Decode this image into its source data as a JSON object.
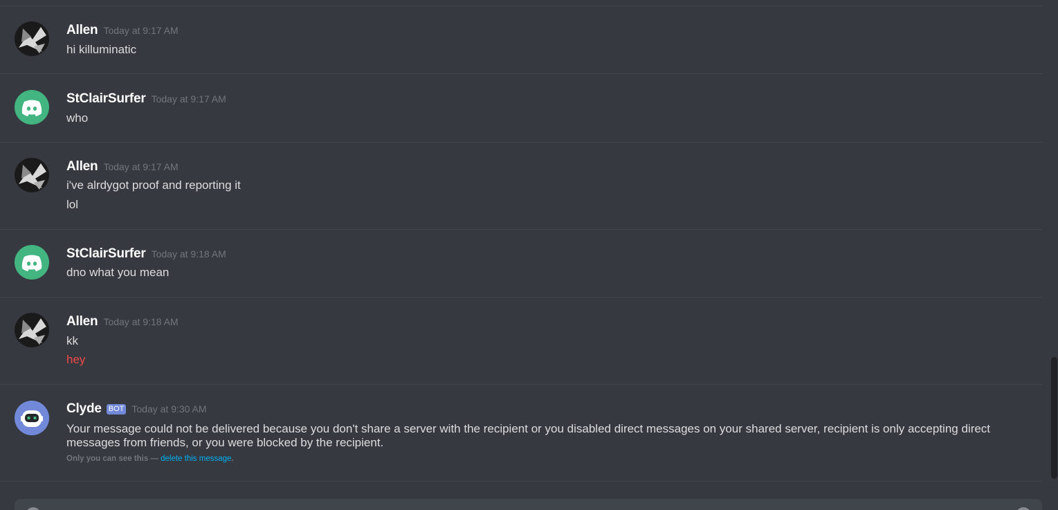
{
  "messages": [
    {
      "author": "Allen",
      "timestamp": "Today at 9:17 AM",
      "avatar": "allen-avatar",
      "lines": [
        "hi killuminatic"
      ]
    },
    {
      "author": "StClairSurfer",
      "timestamp": "Today at 9:17 AM",
      "avatar": "discord-default-avatar",
      "lines": [
        "who"
      ]
    },
    {
      "author": "Allen",
      "timestamp": "Today at 9:17 AM",
      "avatar": "allen-avatar",
      "lines": [
        "i've alrdygot proof and reporting it",
        "lol"
      ]
    },
    {
      "author": "StClairSurfer",
      "timestamp": "Today at 9:18 AM",
      "avatar": "discord-default-avatar",
      "lines": [
        "dno what you mean"
      ]
    },
    {
      "author": "Allen",
      "timestamp": "Today at 9:18 AM",
      "avatar": "allen-avatar",
      "lines": [
        "kk",
        "hey"
      ],
      "failed_line_color": "#f04747"
    },
    {
      "author": "Clyde",
      "bot_tag": "BOT",
      "timestamp": "Today at 9:30 AM",
      "avatar": "clyde-bot-avatar",
      "lines": [
        "Your message could not be delivered because you don't share a server with the recipient or you disabled direct messages on your shared server, recipient is only accepting direct messages from friends, or you were blocked by the recipient."
      ],
      "ephemeral_note": "Only you can see this — ",
      "ephemeral_link": "delete this message",
      "ephemeral_end": "."
    }
  ],
  "colors": {
    "background": "#36393f",
    "divider": "#42454a",
    "author": "#ffffff",
    "text": "#dcddde",
    "timestamp": "#72767d",
    "link": "#00b0f4",
    "bot_tag": "#7289da",
    "discord_green": "#43b581"
  }
}
